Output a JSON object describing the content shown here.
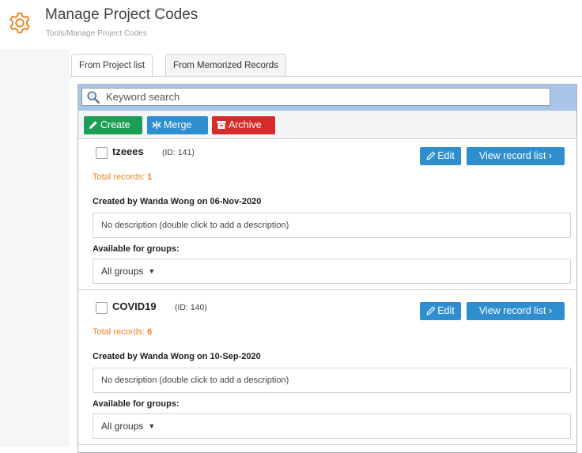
{
  "header": {
    "title": "Manage Project Codes",
    "breadcrumb": "Tools/Manage Project Codes",
    "icon": "gear-icon",
    "accent_color": "#f0821e"
  },
  "tabs": [
    {
      "label": "From Project list",
      "active": true
    },
    {
      "label": "From Memorized Records",
      "active": false
    }
  ],
  "search": {
    "placeholder": "Keyword search",
    "value": ""
  },
  "actions": {
    "create_label": "Create",
    "merge_label": "Merge",
    "archive_label": "Archive",
    "create_color": "#1e9e55",
    "merge_color": "#2f8fce",
    "archive_color": "#d62b2b"
  },
  "records": [
    {
      "name": "tzeees",
      "id_text": "(ID: 141)",
      "total_label": "Total records:",
      "total_count": "1",
      "edit_label": "Edit",
      "view_label": "View record list",
      "created_text": "Created by Wanda Wong on 06-Nov-2020",
      "description": "No description (double click to add a description)",
      "groups_label": "Available for groups:",
      "groups_value": "All groups"
    },
    {
      "name": "COVID19",
      "id_text": "(ID: 140)",
      "total_label": "Total records:",
      "total_count": "6",
      "edit_label": "Edit",
      "view_label": "View record list",
      "created_text": "Created by Wanda Wong on 10-Sep-2020",
      "description": "No description (double click to add a description)",
      "groups_label": "Available for groups:",
      "groups_value": "All groups"
    }
  ]
}
